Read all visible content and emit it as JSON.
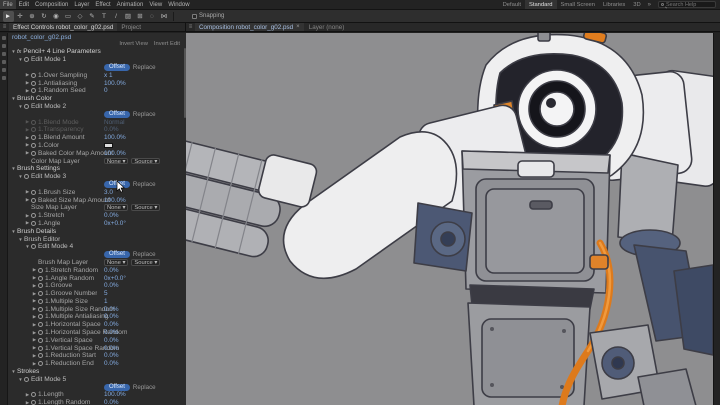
{
  "menu_bar": {
    "items": [
      "File",
      "Edit",
      "Composition",
      "Layer",
      "Effect",
      "Animation",
      "View",
      "Window"
    ]
  },
  "workspace_bar": {
    "items": [
      {
        "label": "Default",
        "active": false
      },
      {
        "label": "Standard",
        "active": true
      },
      {
        "label": "Small Screen",
        "active": false
      },
      {
        "label": "Libraries",
        "active": false
      },
      {
        "label": "3D",
        "active": false
      }
    ],
    "overflow_icon": "»",
    "search_placeholder": "Search Help"
  },
  "toolbar": {
    "tools": [
      "selection-tool",
      "hand-tool",
      "zoom-tool",
      "orbit-camera-tool",
      "camera-tool",
      "pan-behind-tool",
      "shape-tool",
      "pen-tool",
      "type-tool",
      "pencil-tool",
      "brush-tool",
      "clone-stamp-tool",
      "eraser-tool",
      "puppet-tool"
    ],
    "snapping_label": "Snapping"
  },
  "effect_panel": {
    "tabs": [
      {
        "label": "Effect Controls robot_color_g02.psd",
        "active": true
      },
      {
        "label": "Project",
        "active": false
      }
    ],
    "layer_name": "robot_color_g02.psd",
    "links": [
      "Invert View",
      "Invert Edit"
    ],
    "offset_label": "Offset",
    "replace_label": "Replace",
    "rows": [
      {
        "t": "fx",
        "a": "v",
        "label": "Pencil+ 4 Line Parameters"
      },
      {
        "t": "group",
        "i": 1,
        "a": "v",
        "c": 1,
        "label": "Edit Mode 1"
      },
      {
        "t": "btn",
        "i": 2
      },
      {
        "t": "param",
        "i": 2,
        "a": ">",
        "c": 1,
        "label": "1.Over Sampling",
        "val": "x 1"
      },
      {
        "t": "param",
        "i": 2,
        "a": ">",
        "c": 1,
        "label": "1.Antialiasing",
        "val": "100.0%"
      },
      {
        "t": "param",
        "i": 2,
        "a": ">",
        "c": 1,
        "label": "1.Random Seed",
        "val": "0"
      },
      {
        "t": "sec",
        "a": "v",
        "label": "Brush Color"
      },
      {
        "t": "group",
        "i": 1,
        "a": "v",
        "c": 1,
        "label": "Edit Mode 2"
      },
      {
        "t": "btn",
        "i": 2
      },
      {
        "t": "param",
        "i": 2,
        "a": ">",
        "c": 1,
        "label": "1.Blend Mode",
        "val": "Normal",
        "dim": 1
      },
      {
        "t": "param",
        "i": 2,
        "a": ">",
        "c": 1,
        "label": "1.Transparency",
        "val": "0.0%",
        "dim": 1
      },
      {
        "t": "param",
        "i": 2,
        "a": ">",
        "c": 1,
        "label": "1.Blend Amount",
        "val": "100.0%"
      },
      {
        "t": "param",
        "i": 2,
        "a": ">",
        "c": 1,
        "label": "1.Color",
        "swatch": "#dcdcdc"
      },
      {
        "t": "param",
        "i": 2,
        "a": ">",
        "c": 1,
        "label": "Baked Color Map Amount",
        "val": "100.0%"
      },
      {
        "t": "dd",
        "i": 2,
        "label": "Color Map Layer",
        "dd1": "None",
        "dd2": "Source"
      },
      {
        "t": "sec",
        "a": "v",
        "label": "Brush Settings"
      },
      {
        "t": "group",
        "i": 1,
        "a": "v",
        "c": 1,
        "label": "Edit Mode 3"
      },
      {
        "t": "btn",
        "i": 2
      },
      {
        "t": "param",
        "i": 2,
        "a": ">",
        "c": 1,
        "label": "1.Brush Size",
        "val": "3.0"
      },
      {
        "t": "param",
        "i": 2,
        "a": ">",
        "c": 1,
        "label": "Baked Size Map Amount",
        "val": "100.0%"
      },
      {
        "t": "dd",
        "i": 2,
        "label": "Size Map Layer",
        "dd1": "None",
        "dd2": "Source"
      },
      {
        "t": "param",
        "i": 2,
        "a": ">",
        "c": 1,
        "label": "1.Stretch",
        "val": "0.0%"
      },
      {
        "t": "param",
        "i": 2,
        "a": ">",
        "c": 1,
        "label": "1.Angle",
        "val": "0x+0.0°"
      },
      {
        "t": "sec",
        "a": "v",
        "label": "Brush Details"
      },
      {
        "t": "group",
        "i": 1,
        "a": "v",
        "label": "Brush Editor"
      },
      {
        "t": "group",
        "i": 2,
        "a": "v",
        "c": 1,
        "label": "Edit Mode 4"
      },
      {
        "t": "btn",
        "i": 3
      },
      {
        "t": "dd",
        "i": 3,
        "label": "Brush Map Layer",
        "dd1": "None",
        "dd2": "Source"
      },
      {
        "t": "param",
        "i": 3,
        "a": ">",
        "c": 1,
        "label": "1.Stretch Random",
        "val": "0.0%"
      },
      {
        "t": "param",
        "i": 3,
        "a": ">",
        "c": 1,
        "label": "1.Angle Random",
        "val": "0x+0.0°"
      },
      {
        "t": "param",
        "i": 3,
        "a": ">",
        "c": 1,
        "label": "1.Groove",
        "val": "0.0%"
      },
      {
        "t": "param",
        "i": 3,
        "a": ">",
        "c": 1,
        "label": "1.Groove Number",
        "val": "5"
      },
      {
        "t": "param",
        "i": 3,
        "a": ">",
        "c": 1,
        "label": "1.Multiple Size",
        "val": "1"
      },
      {
        "t": "param",
        "i": 3,
        "a": ">",
        "c": 1,
        "label": "1.Multiple Size Random",
        "val": "0.0%"
      },
      {
        "t": "param",
        "i": 3,
        "a": ">",
        "c": 1,
        "label": "1.Multiple Antialiasing",
        "val": "0.0%"
      },
      {
        "t": "param",
        "i": 3,
        "a": ">",
        "c": 1,
        "label": "1.Horizontal Space",
        "val": "0.0%"
      },
      {
        "t": "param",
        "i": 3,
        "a": ">",
        "c": 1,
        "label": "1.Horizontal Space Random",
        "val": "0.0%"
      },
      {
        "t": "param",
        "i": 3,
        "a": ">",
        "c": 1,
        "label": "1.Vertical Space",
        "val": "0.0%"
      },
      {
        "t": "param",
        "i": 3,
        "a": ">",
        "c": 1,
        "label": "1.Vertical Space Random",
        "val": "0.0%"
      },
      {
        "t": "param",
        "i": 3,
        "a": ">",
        "c": 1,
        "label": "1.Reduction Start",
        "val": "0.0%"
      },
      {
        "t": "param",
        "i": 3,
        "a": ">",
        "c": 1,
        "label": "1.Reduction End",
        "val": "0.0%"
      },
      {
        "t": "sec",
        "a": "v",
        "label": "Strokes"
      },
      {
        "t": "group",
        "i": 1,
        "a": "v",
        "c": 1,
        "label": "Edit Mode 5"
      },
      {
        "t": "btn",
        "i": 2
      },
      {
        "t": "param",
        "i": 2,
        "a": ">",
        "c": 1,
        "label": "1.Length",
        "val": "100.0%"
      },
      {
        "t": "param",
        "i": 2,
        "a": ">",
        "c": 1,
        "label": "1.Length Random",
        "val": "0.0%"
      }
    ]
  },
  "viewer": {
    "tab_label": "Composition robot_color_g02.psd",
    "close_label": "×",
    "layer_tab_label": "Layer (none)",
    "canvas_color": "#8e8e90"
  },
  "colors": {
    "accent_blue": "#3866ab",
    "value_blue": "#83aadf",
    "canvas_gray": "#8e8e90",
    "robot_orange": "#dd7a1c"
  }
}
